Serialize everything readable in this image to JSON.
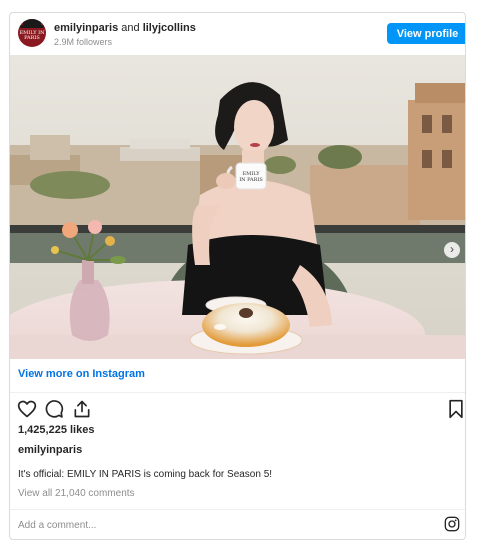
{
  "header": {
    "account": "emilyinparis",
    "connector": "and",
    "collaborator": "lilyjcollins",
    "followers": "2.9M followers",
    "view_profile_label": "View profile",
    "avatar_text": "EMILY IN PARIS"
  },
  "photo": {
    "cup_text_line1": "EMILY",
    "cup_text_line2": "IN PARIS"
  },
  "view_more_label": "View more on Instagram",
  "actions": {
    "like": "heart-icon",
    "comment": "comment-icon",
    "share": "share-icon",
    "save": "bookmark-icon"
  },
  "likes": "1,425,225 likes",
  "owner": "emilyinparis",
  "caption": "It's official: EMILY IN PARIS is coming back for Season 5!",
  "view_comments": "View all 21,040 comments",
  "add_comment_placeholder": "Add a comment...",
  "colors": {
    "accent": "#0095f6",
    "link": "#0073e6",
    "muted": "#8e8e8e"
  }
}
